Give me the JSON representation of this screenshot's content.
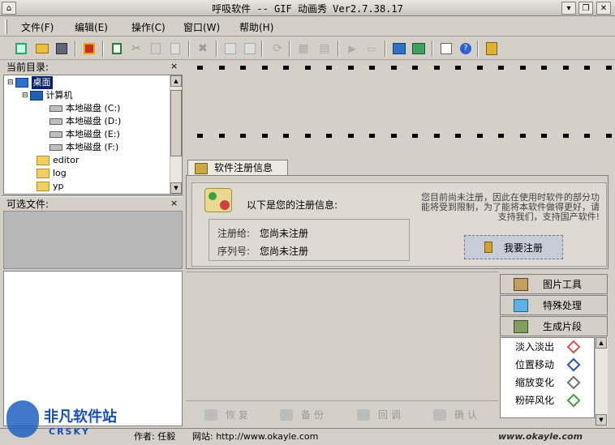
{
  "window": {
    "title": "呼吸软件 -- GIF 动画秀 Ver2.7.38.17"
  },
  "menu": [
    "文件(F)",
    "编辑(E)",
    "操作(C)",
    "窗口(W)",
    "帮助(H)"
  ],
  "panels": {
    "current_dir_title": "当前目录:",
    "available_files_title": "可选文件:",
    "close_glyph": "×"
  },
  "tree": [
    {
      "label": "桌面",
      "selected": true
    },
    {
      "label": "计算机"
    },
    {
      "label": "本地磁盘 (C:)"
    },
    {
      "label": "本地磁盘 (D:)"
    },
    {
      "label": "本地磁盘 (E:)"
    },
    {
      "label": "本地磁盘 (F:)"
    },
    {
      "label": "editor"
    },
    {
      "label": "log"
    },
    {
      "label": "yp"
    }
  ],
  "registration": {
    "tab_label": "软件注册信息",
    "heading": "以下是您的注册信息:",
    "registered_to_label": "注册给:",
    "registered_to_value": "您尚未注册",
    "serial_label": "序列号:",
    "serial_value": "您尚未注册",
    "notice": "您目前尚未注册，因此在使用时软件的部分功能将受到限制，为了能将本软件做得更好，请支持我们，支持国产软件!",
    "register_button": "我要注册"
  },
  "side_tabs": [
    "图片工具",
    "特殊处理",
    "生成片段"
  ],
  "effects": [
    {
      "label": "淡入淡出",
      "color": "#e05050"
    },
    {
      "label": "位置移动",
      "color": "#3050b0"
    },
    {
      "label": "缩放变化",
      "color": "#707070"
    },
    {
      "label": "粉碎风化",
      "color": "#40a040"
    }
  ],
  "actions": [
    "恢 复",
    "备 份",
    "回 调",
    "确 认"
  ],
  "status": {
    "author_label": "作者: 任毅",
    "site_label": "网站: http://www.okayle.com",
    "site_right": "www.okayle.com",
    "watermark": "非凡软件站",
    "watermark_sub": "CRSKY"
  }
}
